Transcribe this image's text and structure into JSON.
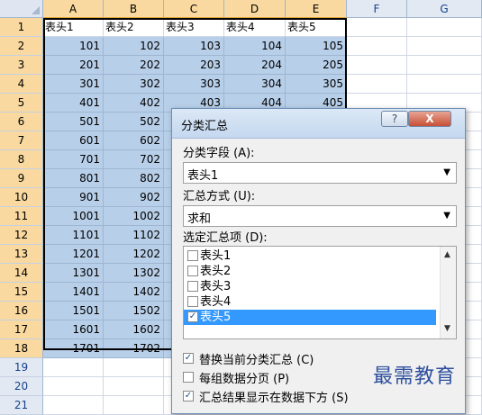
{
  "sheet": {
    "columns": [
      "A",
      "B",
      "C",
      "D",
      "E",
      "F",
      "G"
    ],
    "rows": [
      "1",
      "2",
      "3",
      "4",
      "5",
      "6",
      "7",
      "8",
      "9",
      "10",
      "11",
      "12",
      "13",
      "14",
      "15",
      "16",
      "17",
      "18",
      "19",
      "20",
      "21"
    ],
    "header_cells": [
      "表头1",
      "表头2",
      "表头3",
      "表头4",
      "表头5"
    ],
    "data": [
      [
        "101",
        "102",
        "103",
        "104",
        "105"
      ],
      [
        "201",
        "202",
        "203",
        "204",
        "205"
      ],
      [
        "301",
        "302",
        "303",
        "304",
        "305"
      ],
      [
        "401",
        "402",
        "403",
        "404",
        "405"
      ],
      [
        "501",
        "502",
        "",
        "",
        ""
      ],
      [
        "601",
        "602",
        "",
        "",
        ""
      ],
      [
        "701",
        "702",
        "",
        "",
        ""
      ],
      [
        "801",
        "802",
        "",
        "",
        ""
      ],
      [
        "901",
        "902",
        "",
        "",
        ""
      ],
      [
        "1001",
        "1002",
        "",
        "",
        ""
      ],
      [
        "1101",
        "1102",
        "",
        "",
        ""
      ],
      [
        "1201",
        "1202",
        "",
        "",
        ""
      ],
      [
        "1301",
        "1302",
        "",
        "",
        ""
      ],
      [
        "1401",
        "1402",
        "",
        "",
        ""
      ],
      [
        "1501",
        "1502",
        "",
        "",
        ""
      ],
      [
        "1601",
        "1602",
        "",
        "",
        ""
      ],
      [
        "1701",
        "1702",
        "",
        "",
        ""
      ]
    ]
  },
  "dialog": {
    "title": "分类汇总",
    "help_label": "?",
    "close_label": "X",
    "group_field_label": "分类字段 (A):",
    "group_field_value": "表头1",
    "function_label": "汇总方式 (U):",
    "function_value": "求和",
    "items_label": "选定汇总项 (D):",
    "items": [
      {
        "label": "表头1",
        "checked": false,
        "selected": false
      },
      {
        "label": "表头2",
        "checked": false,
        "selected": false
      },
      {
        "label": "表头3",
        "checked": false,
        "selected": false
      },
      {
        "label": "表头4",
        "checked": false,
        "selected": false
      },
      {
        "label": "表头5",
        "checked": true,
        "selected": true
      }
    ],
    "options": [
      {
        "label": "替换当前分类汇总 (C)",
        "checked": true
      },
      {
        "label": "每组数据分页 (P)",
        "checked": false
      },
      {
        "label": "汇总结果显示在数据下方 (S)",
        "checked": true
      }
    ],
    "check_glyph": "✓",
    "dropdown_icon": "▼",
    "scroll_up_icon": "▲",
    "scroll_down_icon": "▼"
  },
  "watermark": "最需教育",
  "colors": {
    "selection": "#b8cfe9",
    "header_selected": "#f9d99f",
    "list_highlight": "#3399ff",
    "watermark": "#2d4f9e"
  }
}
